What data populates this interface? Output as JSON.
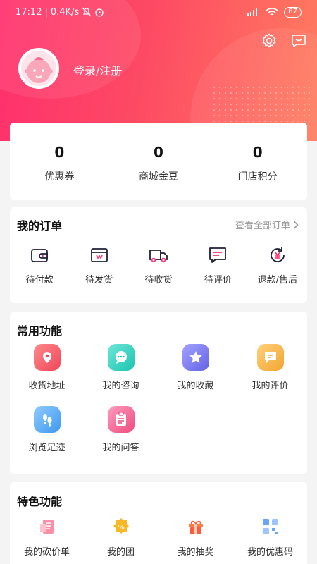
{
  "status_bar": {
    "time": "17:12",
    "speed": "0.4K/s",
    "battery": "87"
  },
  "header": {
    "login_text": "登录/注册"
  },
  "stats": [
    {
      "value": "0",
      "label": "优惠券"
    },
    {
      "value": "0",
      "label": "商城金豆"
    },
    {
      "value": "0",
      "label": "门店积分"
    }
  ],
  "orders": {
    "title": "我的订单",
    "see_all": "查看全部订单",
    "items": [
      {
        "label": "待付款",
        "icon": "wallet-icon"
      },
      {
        "label": "待发货",
        "icon": "box-icon"
      },
      {
        "label": "待收货",
        "icon": "truck-icon"
      },
      {
        "label": "待评价",
        "icon": "comment-icon"
      },
      {
        "label": "退款/售后",
        "icon": "refund-icon"
      }
    ]
  },
  "common": {
    "title": "常用功能",
    "items": [
      {
        "label": "收货地址",
        "icon": "location-icon",
        "color": "#f5606a"
      },
      {
        "label": "我的咨询",
        "icon": "chat-icon",
        "color": "#2fd1c0"
      },
      {
        "label": "我的收藏",
        "icon": "star-icon",
        "color": "#7d7cf2"
      },
      {
        "label": "我的评价",
        "icon": "review-icon",
        "color": "#f6b44c"
      },
      {
        "label": "浏览足迹",
        "icon": "footprint-icon",
        "color": "#4aa8f5"
      },
      {
        "label": "我的问答",
        "icon": "clipboard-icon",
        "color": "#f45a8a"
      }
    ]
  },
  "special": {
    "title": "特色功能",
    "items": [
      {
        "label": "我的砍价单",
        "icon": "bargain-icon"
      },
      {
        "label": "我的团",
        "icon": "group-buy-icon"
      },
      {
        "label": "我的抽奖",
        "icon": "gift-icon"
      },
      {
        "label": "我的优惠码",
        "icon": "qrcode-icon"
      }
    ]
  },
  "colors": {
    "accent": "#ff2f6d",
    "accent2": "#ff7d5f"
  }
}
